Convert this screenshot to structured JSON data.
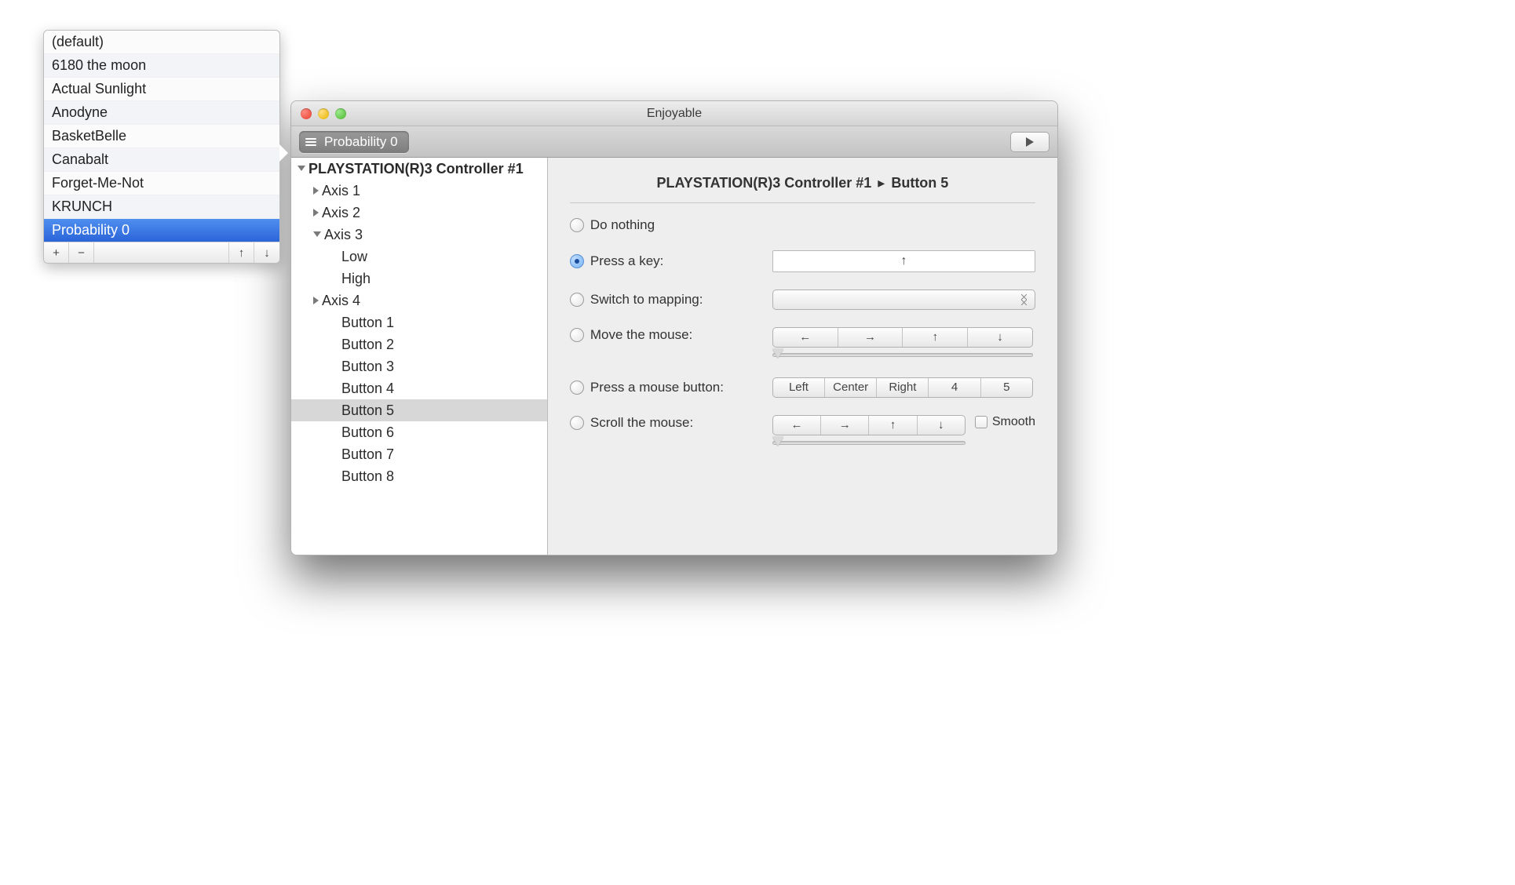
{
  "popover": {
    "items": [
      "(default)",
      "6180 the moon",
      "Actual Sunlight",
      "Anodyne",
      "BasketBelle",
      "Canabalt",
      "Forget-Me-Not",
      "KRUNCH",
      "Probability 0"
    ],
    "selected_index": 8,
    "buttons": {
      "add": "+",
      "remove": "−",
      "moveUp": "↑",
      "moveDown": "↓"
    }
  },
  "window": {
    "title": "Enjoyable"
  },
  "toolbar": {
    "mapping_chip": "Probability 0"
  },
  "tree": {
    "controller": "PLAYSTATION(R)3 Controller #1",
    "items": [
      {
        "label": "Axis 1",
        "indent": 1,
        "disclosure": "closed"
      },
      {
        "label": "Axis 2",
        "indent": 1,
        "disclosure": "closed"
      },
      {
        "label": "Axis 3",
        "indent": 1,
        "disclosure": "open"
      },
      {
        "label": "Low",
        "indent": 2
      },
      {
        "label": "High",
        "indent": 2
      },
      {
        "label": "Axis 4",
        "indent": 1,
        "disclosure": "closed"
      },
      {
        "label": "Button 1",
        "indent": 2
      },
      {
        "label": "Button 2",
        "indent": 2
      },
      {
        "label": "Button 3",
        "indent": 2
      },
      {
        "label": "Button 4",
        "indent": 2
      },
      {
        "label": "Button 5",
        "indent": 2,
        "selected": true
      },
      {
        "label": "Button 6",
        "indent": 2
      },
      {
        "label": "Button 7",
        "indent": 2
      },
      {
        "label": "Button 8",
        "indent": 2
      }
    ]
  },
  "detail": {
    "header_device": "PLAYSTATION(R)3 Controller #1",
    "header_input": "Button 5",
    "options": {
      "do_nothing": "Do nothing",
      "press_key": "Press a key:",
      "switch_mapping": "Switch to mapping:",
      "move_mouse": "Move the mouse:",
      "press_mouse": "Press a mouse button:",
      "scroll_mouse": "Scroll the mouse:"
    },
    "selected_option": "press_key",
    "key_value": "↑",
    "move_dirs": [
      "←",
      "→",
      "↑",
      "↓"
    ],
    "mouse_buttons": [
      "Left",
      "Center",
      "Right",
      "4",
      "5"
    ],
    "scroll_dirs": [
      "←",
      "→",
      "↑",
      "↓"
    ],
    "smooth_label": "Smooth"
  }
}
